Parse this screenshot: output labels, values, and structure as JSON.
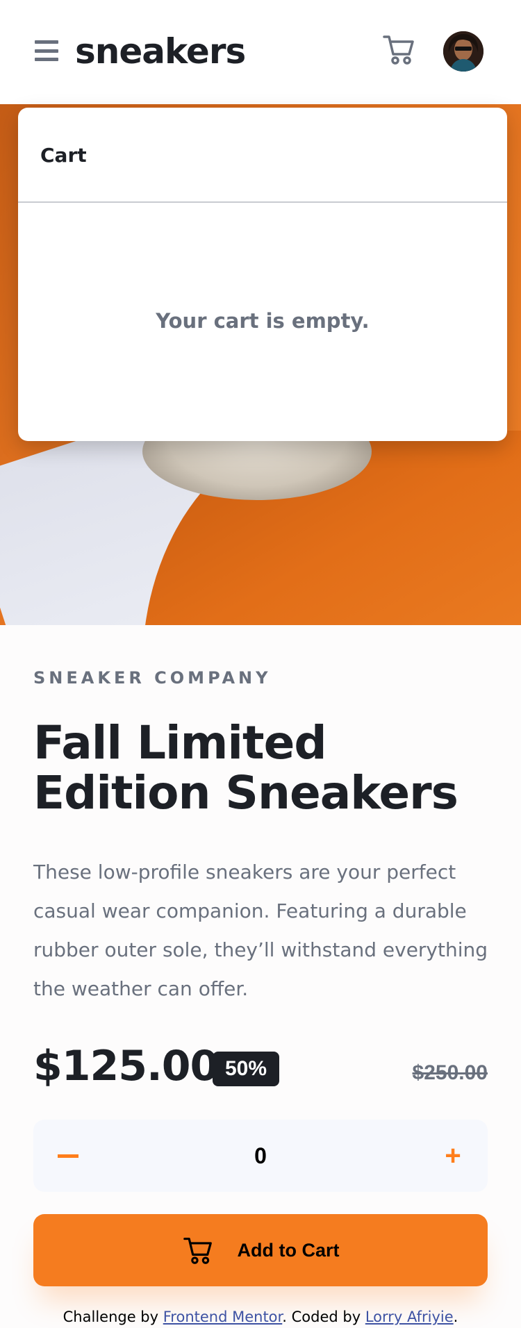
{
  "header": {
    "brand": "sneakers"
  },
  "cart": {
    "title": "Cart",
    "empty_message": "Your cart is empty."
  },
  "product": {
    "company": "SNEAKER COMPANY",
    "title": "Fall Limited Edition Sneakers",
    "description": "These low-profile sneakers are your perfect casual wear companion. Featuring a durable rubber outer sole, they’ll withstand everything the weather can offer.",
    "price": "$125.00",
    "discount": "50%",
    "original_price": "$250.00"
  },
  "quantity": {
    "minus_label": "−",
    "plus_label": "+",
    "value": "0"
  },
  "add_to_cart": {
    "label": "Add to Cart"
  },
  "footer": {
    "prefix": "Challenge by ",
    "challenge_link": "Frontend Mentor",
    "middle": ". Coded by ",
    "author_link": "Lorry Afriyie",
    "suffix": "."
  },
  "colors": {
    "accent": "#ff7e1b",
    "dark": "#1d2026",
    "muted": "#69707d"
  },
  "icons": {
    "menu": "menu-icon",
    "cart": "cart-icon",
    "avatar": "avatar-image"
  }
}
